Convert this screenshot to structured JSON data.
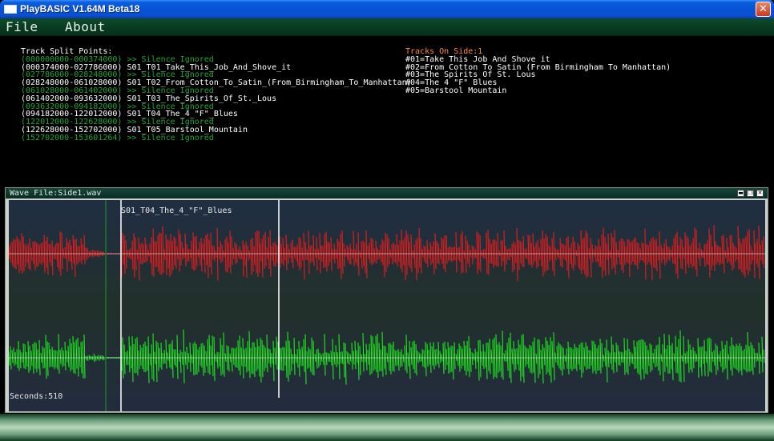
{
  "window": {
    "title": "PlayBASIC V1.64M Beta18",
    "close_glyph": "✕"
  },
  "menu": {
    "items": [
      "File",
      "About"
    ]
  },
  "split_points": {
    "heading": "Track Split Points:",
    "lines": [
      {
        "text": "(000000000-000374000) >> Silence Ignored",
        "kind": "silence"
      },
      {
        "text": "(000374000-027786000) S01_T01_Take_This_Job_And_Shove_it",
        "kind": "track"
      },
      {
        "text": "(027786000-028248000) >> Silence Ignored",
        "kind": "silence"
      },
      {
        "text": "(028248000-061028000) S01_T02_From_Cotton_To_Satin_(From_Birmingham_To_Manhattan)",
        "kind": "track"
      },
      {
        "text": "(061028000-061402000) >> Silence Ignored",
        "kind": "silence"
      },
      {
        "text": "(061402000-093632000) S01_T03_The_Spirits_Of_St._Lous",
        "kind": "track"
      },
      {
        "text": "(093632000-094182000) >> Silence Ignored",
        "kind": "silence"
      },
      {
        "text": "(094182000-122012000) S01_T04_The_4_\"F\"_Blues",
        "kind": "track"
      },
      {
        "text": "(122012000-122628000) >> Silence Ignored",
        "kind": "silence"
      },
      {
        "text": "(122628000-152702000) S01_T05_Barstool_Mountain",
        "kind": "track"
      },
      {
        "text": "(152702000-153601264) >> Silence Ignored",
        "kind": "silence"
      }
    ]
  },
  "tracks": {
    "heading": "Tracks On Side:1",
    "items": [
      "#01=Take This Job And Shove it",
      "#02=From Cotton To Satin (From Birmingham To Manhattan)",
      "#03=The Spirits Of St. Lous",
      "#04=The 4 \"F\" Blues",
      "#05=Barstool Mountain"
    ]
  },
  "wave_window": {
    "title": "Wave File:Side1.wav",
    "current_track": "S01_T04_The_4_\"F\"_Blues",
    "seconds_label": "Seconds:510",
    "buttons": {
      "minimize": "▬",
      "restore": "❐",
      "close": "✕"
    },
    "colors": {
      "left_channel": "#ff1a1a",
      "right_channel": "#1cff1c",
      "marker": "#ffffff",
      "start_marker": "#1a7a2a"
    }
  }
}
